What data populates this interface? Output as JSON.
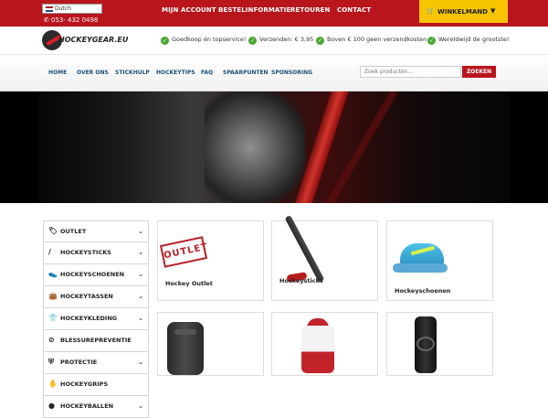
{
  "colors": {
    "brand_red": "#b9151d",
    "cart_yellow": "#f6c500",
    "nav_blue": "#1c4e78",
    "check_green": "#4ba833"
  },
  "topbar": {
    "language": "Dutch",
    "phone": "053- 432 0498",
    "nav": [
      "MIJN ACCOUNT",
      "BESTELINFORMATIE",
      "RETOUREN",
      "CONTACT"
    ],
    "cart_label": "WINKELMAND"
  },
  "header": {
    "logo_text": "HOCKEYGEAR.EU",
    "usps": [
      "Goedkoop én topservice!",
      "Verzenden: € 3,95",
      "Boven € 100 geen verzendkosten",
      "Wereldwijd de grootste!"
    ]
  },
  "nav": {
    "items": [
      "HOME",
      "OVER ONS",
      "STICKHULP",
      "HOCKEYTIPS",
      "FAQ",
      "SPAARPUNTEN",
      "SPONSORING"
    ],
    "search_placeholder": "Zoek producten...",
    "search_button": "ZOEKEN"
  },
  "categories": [
    {
      "label": "OUTLET",
      "icon": "tag-icon",
      "has_arrow": true
    },
    {
      "label": "HOCKEYSTICKS",
      "icon": "hockey-stick-icon",
      "has_arrow": true
    },
    {
      "label": "HOCKEYSCHOENEN",
      "icon": "shoe-icon",
      "has_arrow": true
    },
    {
      "label": "HOCKEYTASSEN",
      "icon": "bag-icon",
      "has_arrow": true
    },
    {
      "label": "HOCKEYKLEDING",
      "icon": "shirt-icon",
      "has_arrow": true
    },
    {
      "label": "BLESSUREPREVENTIE",
      "icon": "bandage-icon",
      "has_arrow": false
    },
    {
      "label": "PROTECTIE",
      "icon": "shield-icon",
      "has_arrow": true
    },
    {
      "label": "HOCKEYGRIPS",
      "icon": "grip-hand-icon",
      "has_arrow": false
    },
    {
      "label": "HOCKEYBALLEN",
      "icon": "ball-icon",
      "has_arrow": true
    }
  ],
  "products": [
    {
      "label": "Hockey Outlet",
      "stamp": "OUTLET"
    },
    {
      "label": "Hockeysticks"
    },
    {
      "label": "Hockeyschoenen"
    },
    {
      "label": ""
    },
    {
      "label": ""
    },
    {
      "label": ""
    }
  ]
}
